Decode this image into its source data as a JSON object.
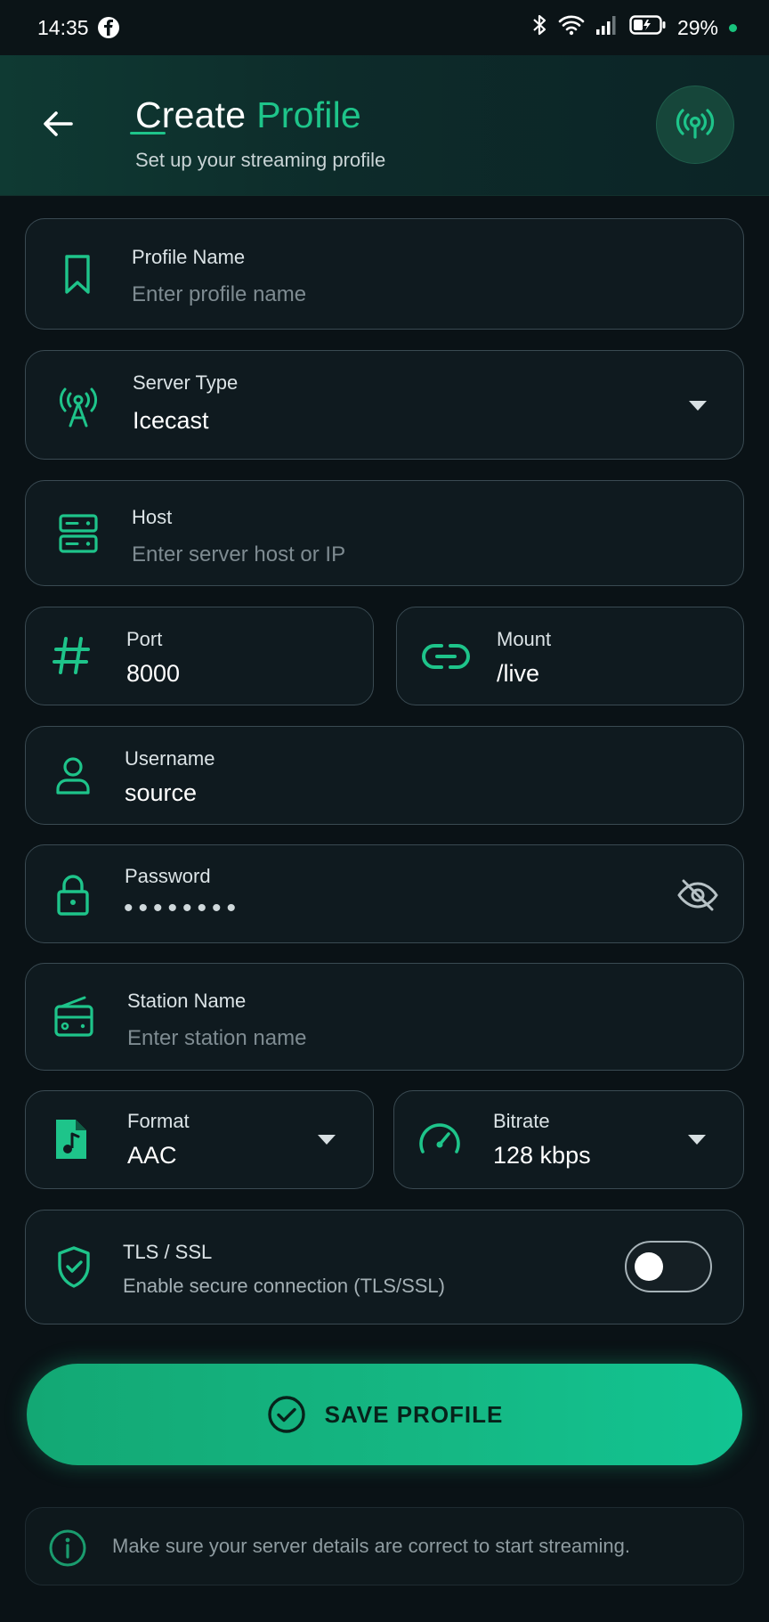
{
  "status_bar": {
    "time": "14:35",
    "battery": "29%",
    "icons": [
      "facebook-icon",
      "bluetooth-icon",
      "wifi-icon",
      "signal-icon",
      "battery-icon"
    ]
  },
  "header": {
    "title_word1": "Create",
    "title_word2": "Profile",
    "subtitle": "Set up your streaming profile"
  },
  "form": {
    "profile_name": {
      "label": "Profile Name",
      "placeholder": "Enter profile name"
    },
    "server_type": {
      "label": "Server Type",
      "value": "Icecast"
    },
    "host": {
      "label": "Host",
      "placeholder": "Enter server host or IP"
    },
    "port": {
      "label": "Port",
      "value": "8000"
    },
    "mount": {
      "label": "Mount",
      "value": "/live"
    },
    "username": {
      "label": "Username",
      "value": "source"
    },
    "password": {
      "label": "Password",
      "masked": "••••••••"
    },
    "station_name": {
      "label": "Station Name",
      "placeholder": "Enter station name"
    },
    "format": {
      "label": "Format",
      "value": "AAC"
    },
    "bitrate": {
      "label": "Bitrate",
      "value": "128 kbps"
    },
    "tls": {
      "label": "TLS / SSL",
      "description": "Enable secure connection (TLS/SSL)",
      "enabled": false
    }
  },
  "save_button": {
    "label": "SAVE PROFILE"
  },
  "info": {
    "text": "Make sure your server details are correct to start streaming."
  },
  "colors": {
    "accent": "#1ec48a",
    "background": "#0a1216",
    "card_border": "#3a4a52",
    "button": "#15b884"
  }
}
